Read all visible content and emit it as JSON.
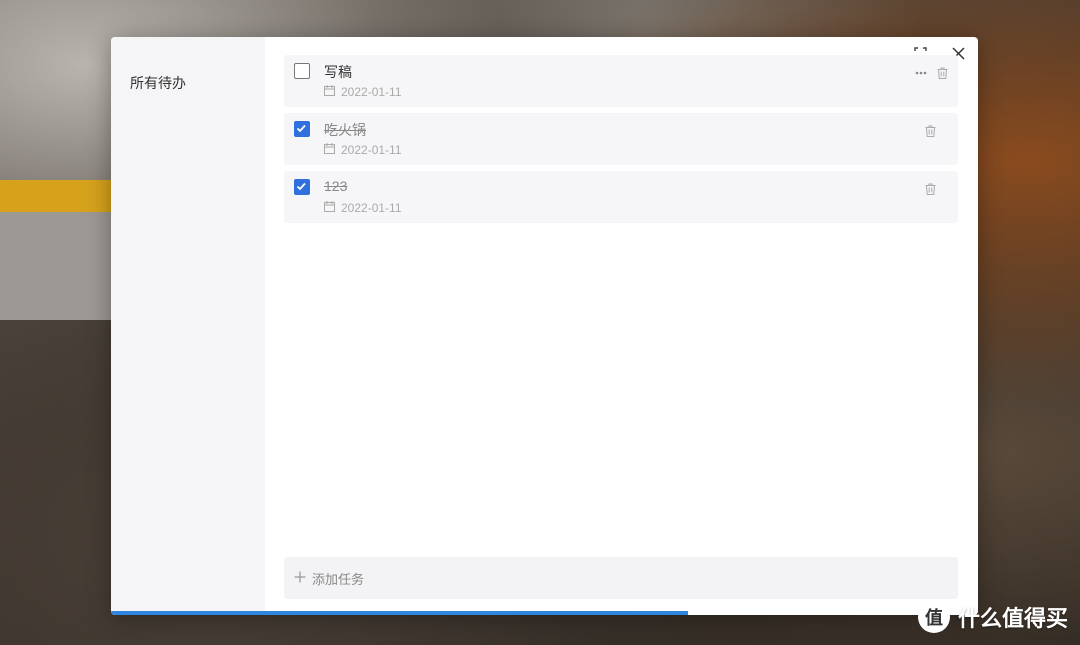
{
  "sidebar": {
    "items": [
      {
        "label": "所有待办"
      }
    ]
  },
  "toolbar": {
    "expand_icon": "expand-icon",
    "close_icon": "close-icon"
  },
  "tasks": [
    {
      "title": "写稿",
      "date": "2022-01-11",
      "done": false
    },
    {
      "title": "吃火锅",
      "date": "2022-01-11",
      "done": true
    },
    {
      "title": "123",
      "date": "2022-01-11",
      "done": true
    }
  ],
  "add_task": {
    "label": "添加任务"
  },
  "progress": {
    "fraction": 0.665
  },
  "watermark": {
    "logo_text": "值",
    "text": "什么值得买"
  },
  "colors": {
    "accent": "#2f6fde",
    "progress": "#2f86de"
  }
}
